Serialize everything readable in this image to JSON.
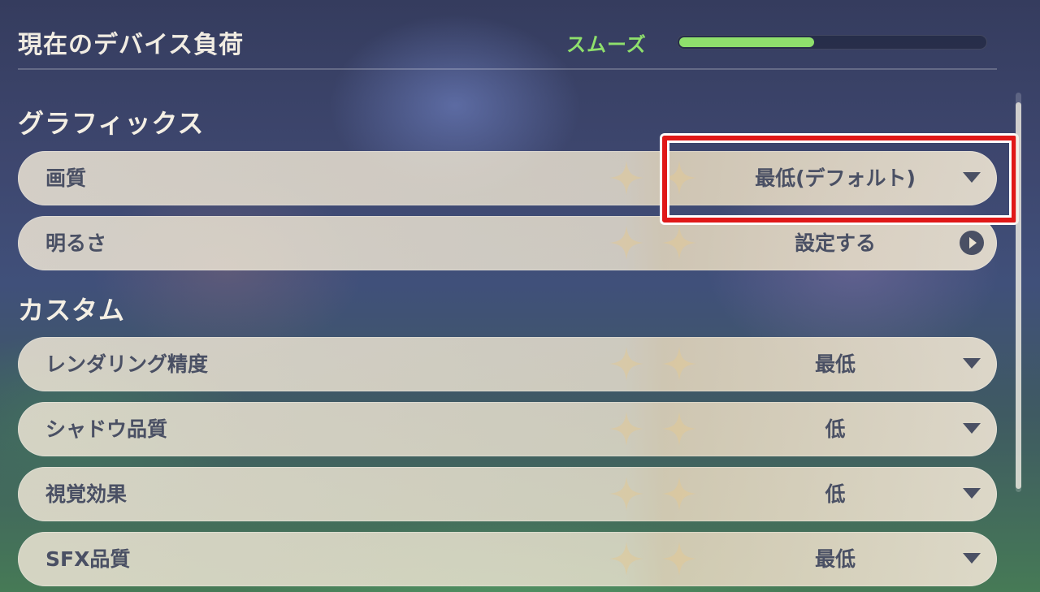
{
  "header": {
    "title": "現在のデバイス負荷",
    "status": "スムーズ",
    "load_level": 0.44
  },
  "sections": {
    "graphics": {
      "title": "グラフィックス"
    },
    "custom": {
      "title": "カスタム"
    }
  },
  "settings": {
    "image_quality": {
      "label": "画質",
      "value": "最低(デフォルト)",
      "control": "dropdown"
    },
    "brightness": {
      "label": "明るさ",
      "value": "設定する",
      "control": "arrow"
    },
    "render_resolution": {
      "label": "レンダリング精度",
      "value": "最低",
      "control": "dropdown"
    },
    "shadow_quality": {
      "label": "シャドウ品質",
      "value": "低",
      "control": "dropdown"
    },
    "visual_effects": {
      "label": "視覚効果",
      "value": "低",
      "control": "dropdown"
    },
    "sfx_quality": {
      "label": "SFX品質",
      "value": "最低",
      "control": "dropdown"
    }
  },
  "colors": {
    "status_green": "#8fe06c",
    "row_text": "#4a5064",
    "highlight_red": "#e01818"
  },
  "icons": {
    "dropdown": "chevron-down-icon",
    "arrow": "arrow-right-circle-icon",
    "ornament": "sparkle-icon"
  }
}
